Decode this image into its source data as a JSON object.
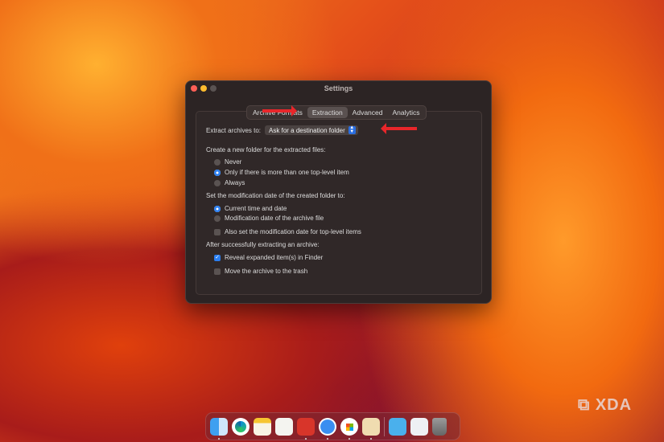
{
  "window": {
    "title": "Settings"
  },
  "tabs": [
    {
      "label": "Archive Formats"
    },
    {
      "label": "Extraction"
    },
    {
      "label": "Advanced"
    },
    {
      "label": "Analytics"
    }
  ],
  "extract": {
    "label": "Extract archives to:",
    "value": "Ask for a destination folder"
  },
  "new_folder": {
    "heading": "Create a new folder for the extracted files:",
    "options": [
      "Never",
      "Only if there is more than one top-level item",
      "Always"
    ],
    "selected": 1
  },
  "mod_date": {
    "heading": "Set the modification date of the created folder to:",
    "options": [
      "Current time and date",
      "Modification date of the archive file"
    ],
    "selected": 0,
    "also_label": "Also set the modification date for top-level items",
    "also_checked": false
  },
  "after": {
    "heading": "After successfully extracting an archive:",
    "reveal_label": "Reveal expanded item(s) in Finder",
    "reveal_checked": true,
    "trash_label": "Move the archive to the trash",
    "trash_checked": false
  },
  "dock": [
    "Finder",
    "Edge",
    "Notes",
    "TextEdit",
    "Presentation",
    "Safari",
    "Microsoft Store",
    "Archive Utility",
    "Downloads",
    "Preview",
    "Trash"
  ],
  "watermark": "XDA"
}
